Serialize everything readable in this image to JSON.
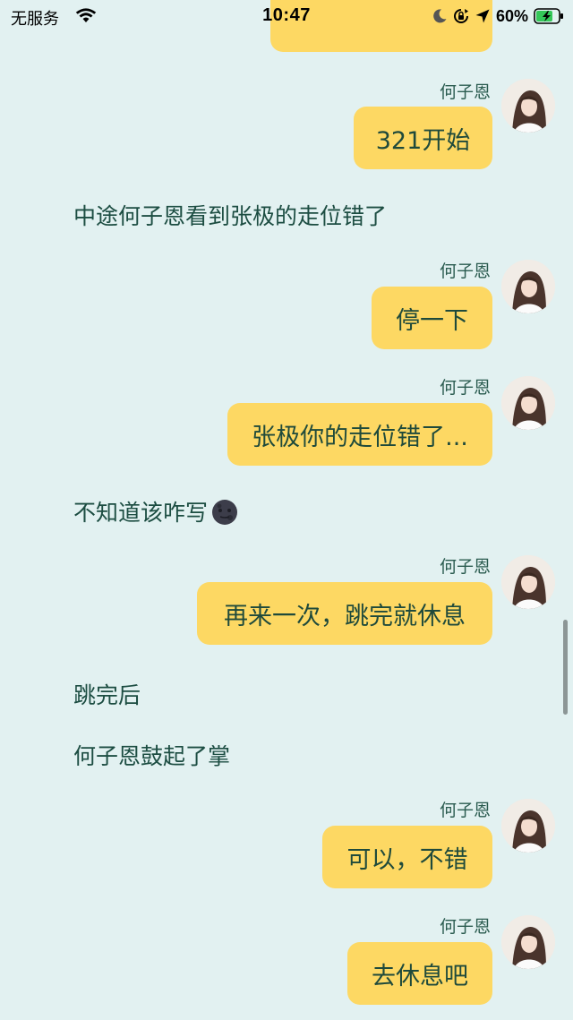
{
  "status_bar": {
    "carrier": "无服务",
    "time": "10:47",
    "battery_percent": "60%",
    "icons": [
      "wifi-icon",
      "moon-icon",
      "orientation-lock-icon",
      "location-arrow-icon",
      "battery-charging-icon"
    ]
  },
  "chat": {
    "speaker_name": "何子恩",
    "messages": [
      {
        "type": "bubble",
        "text": "321开始"
      },
      {
        "type": "narration",
        "text": "中途何子恩看到张极的走位错了"
      },
      {
        "type": "bubble",
        "text": "停一下"
      },
      {
        "type": "bubble",
        "text": "张极你的走位错了..."
      },
      {
        "type": "narration",
        "text": "不知道该咋写",
        "emoji": "new-moon-face-icon"
      },
      {
        "type": "bubble",
        "text": "再来一次，跳完就休息"
      },
      {
        "type": "narration",
        "text": "跳完后"
      },
      {
        "type": "narration",
        "text": "何子恩鼓起了掌"
      },
      {
        "type": "bubble",
        "text": "可以，不错"
      },
      {
        "type": "bubble",
        "text": "去休息吧"
      }
    ]
  },
  "colors": {
    "background": "#e2f1f1",
    "bubble": "#fdd863",
    "text": "#1f4a3b"
  }
}
